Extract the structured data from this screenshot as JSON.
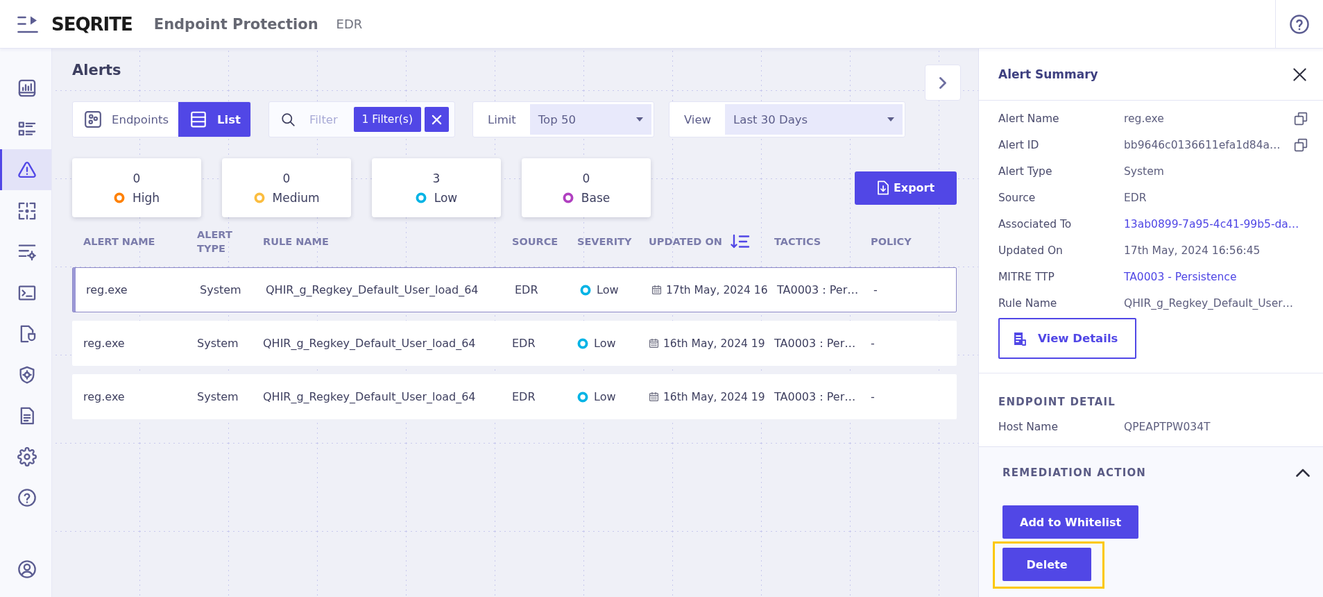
{
  "header": {
    "logo": "SEQRITE",
    "app_name": "Endpoint Protection",
    "module": "EDR"
  },
  "sidebar": {
    "items": [
      {
        "selected": false
      },
      {
        "selected": false
      },
      {
        "selected": true
      },
      {
        "selected": false
      },
      {
        "selected": false
      },
      {
        "selected": false
      },
      {
        "selected": false
      },
      {
        "selected": false
      },
      {
        "selected": false
      },
      {
        "selected": false
      },
      {
        "selected": false
      }
    ]
  },
  "page": {
    "title": "Alerts"
  },
  "toolbar": {
    "view_toggle": [
      {
        "label": "Endpoints",
        "selected": false
      },
      {
        "label": "List",
        "selected": true
      }
    ],
    "filter": {
      "placeholder": "Filter",
      "chip": "1 Filter(s)"
    },
    "limit": {
      "label": "Limit",
      "value": "Top 50"
    },
    "view": {
      "label": "View",
      "value": "Last 30 Days"
    }
  },
  "severity_cards": [
    {
      "count": "0",
      "label": "High",
      "color": "#ff8000"
    },
    {
      "count": "0",
      "label": "Medium",
      "color": "#fbbd3f"
    },
    {
      "count": "3",
      "label": "Low",
      "color": "#00b3e5"
    },
    {
      "count": "0",
      "label": "Base",
      "color": "#b040c0"
    }
  ],
  "export_button": "Export",
  "table": {
    "columns": [
      {
        "label": "ALERT NAME",
        "sorted": false
      },
      {
        "label": "ALERT TYPE",
        "sorted": false
      },
      {
        "label": "RULE NAME",
        "sorted": false
      },
      {
        "label": "SOURCE",
        "sorted": false
      },
      {
        "label": "SEVERITY",
        "sorted": false
      },
      {
        "label": "UPDATED ON",
        "sorted": true
      },
      {
        "label": "TACTICS",
        "sorted": false
      },
      {
        "label": "POLICY",
        "sorted": false
      }
    ],
    "rows": [
      {
        "selected": true,
        "alert_name": "reg.exe",
        "alert_type": "System",
        "rule_name": "QHIR_g_Regkey_Default_User_load_64",
        "source": "EDR",
        "severity": {
          "label": "Low",
          "color": "#00b3e5"
        },
        "updated_on": "17th May, 2024 16",
        "tactics": "TA0003 : Per…",
        "policy": "-"
      },
      {
        "selected": false,
        "alert_name": "reg.exe",
        "alert_type": "System",
        "rule_name": "QHIR_g_Regkey_Default_User_load_64",
        "source": "EDR",
        "severity": {
          "label": "Low",
          "color": "#00b3e5"
        },
        "updated_on": "16th May, 2024 19",
        "tactics": "TA0003 : Per…",
        "policy": "-"
      },
      {
        "selected": false,
        "alert_name": "reg.exe",
        "alert_type": "System",
        "rule_name": "QHIR_g_Regkey_Default_User_load_64",
        "source": "EDR",
        "severity": {
          "label": "Low",
          "color": "#00b3e5"
        },
        "updated_on": "16th May, 2024 19",
        "tactics": "TA0003 : Per…",
        "policy": "-"
      }
    ]
  },
  "summary": {
    "title": "Alert Summary",
    "fields": [
      {
        "label": "Alert Name",
        "value": "reg.exe",
        "kind": "copy"
      },
      {
        "label": "Alert ID",
        "value": "bb9646c0136611efa1d84a…",
        "kind": "copy"
      },
      {
        "label": "Alert Type",
        "value": "System",
        "kind": "text"
      },
      {
        "label": "Source",
        "value": "EDR",
        "kind": "text"
      },
      {
        "label": "Associated To",
        "value": "13ab0899-7a95-4c41-99b5-da…",
        "kind": "link"
      },
      {
        "label": "Updated On",
        "value": "17th May, 2024 16:56:45",
        "kind": "text"
      },
      {
        "label": "MITRE TTP",
        "value": "TA0003 - Persistence",
        "kind": "link"
      },
      {
        "label": "Rule Name",
        "value": "QHIR_g_Regkey_Default_User…",
        "kind": "text"
      }
    ],
    "view_details": "View Details",
    "endpoint_detail": {
      "title": "ENDPOINT DETAIL",
      "fields": [
        {
          "label": "Host Name",
          "value": "QPEAPTPW034T"
        }
      ]
    },
    "remediation": {
      "title": "REMEDIATION ACTION",
      "expanded": true,
      "actions": [
        {
          "label": "Add to Whitelist",
          "highlighted": false
        },
        {
          "label": "Delete",
          "highlighted": true
        }
      ]
    }
  }
}
